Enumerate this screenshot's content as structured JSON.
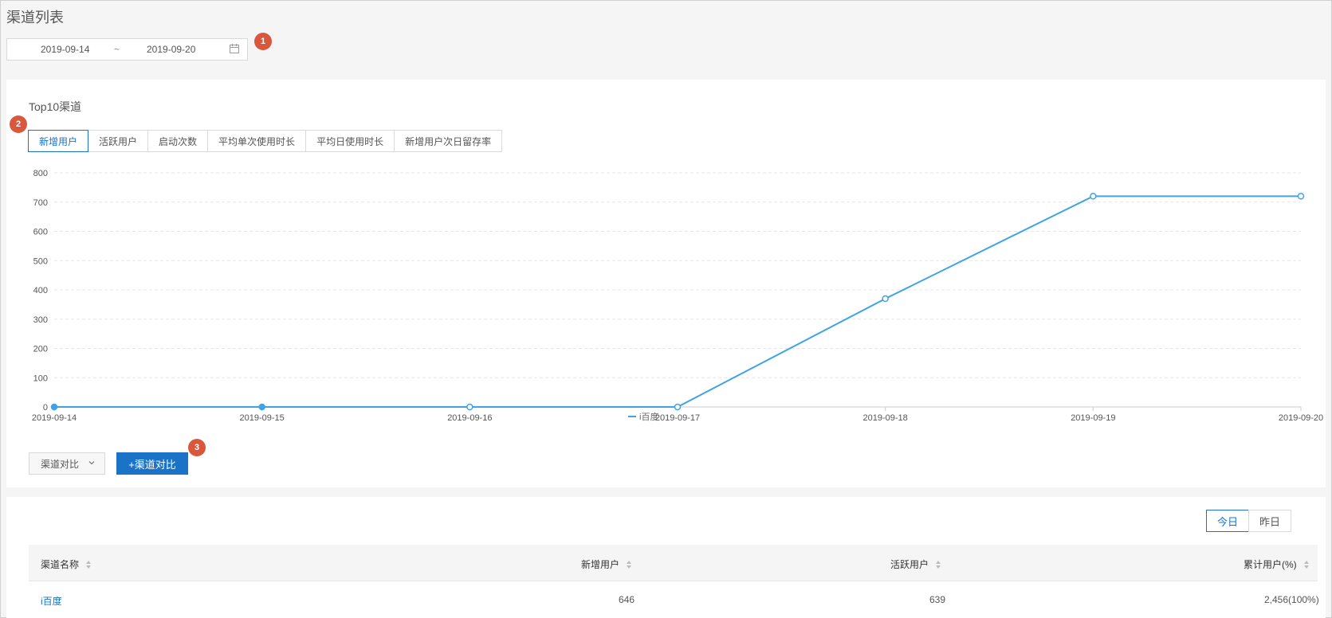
{
  "header": {
    "title": "渠道列表"
  },
  "date_range": {
    "start": "2019-09-14",
    "separator": "~",
    "end": "2019-09-20"
  },
  "badges": [
    "1",
    "2",
    "3"
  ],
  "top_section": {
    "label": "Top10渠道"
  },
  "metric_tabs": [
    {
      "label": "新增用户",
      "active": true
    },
    {
      "label": "活跃用户",
      "active": false
    },
    {
      "label": "启动次数",
      "active": false
    },
    {
      "label": "平均单次使用时长",
      "active": false
    },
    {
      "label": "平均日使用时长",
      "active": false
    },
    {
      "label": "新增用户次日留存率",
      "active": false
    }
  ],
  "chart_data": {
    "type": "line",
    "categories": [
      "2019-09-14",
      "2019-09-15",
      "2019-09-16",
      "2019-09-17",
      "2019-09-18",
      "2019-09-19",
      "2019-09-20"
    ],
    "series": [
      {
        "name": "i百度",
        "values": [
          0,
          0,
          0,
          0,
          370,
          720,
          720
        ],
        "color": "#3fa3e6"
      }
    ],
    "yticks": [
      0,
      100,
      200,
      300,
      400,
      500,
      600,
      700,
      800
    ],
    "ylim": [
      0,
      800
    ],
    "title": "",
    "xlabel": "",
    "ylabel": "",
    "grid": true,
    "legend": "bottom-center"
  },
  "controls": {
    "compare_select_label": "渠道对比",
    "add_compare_label": "+渠道对比"
  },
  "day_toggle": {
    "today": "今日",
    "yesterday": "昨日",
    "active": "today"
  },
  "table": {
    "headers": [
      "渠道名称",
      "新增用户",
      "活跃用户",
      "累计用户(%)"
    ],
    "rows": [
      {
        "name": "i百度",
        "new_users": "646",
        "active_users": "639",
        "total_users": "2,456(100%)"
      }
    ]
  },
  "colors": {
    "accent": "#1a73c7",
    "badge": "#d9573b",
    "line": "#3fa3e6"
  },
  "icons": {
    "calendar": "calendar-icon",
    "chevron": "chevron-down-icon",
    "sort": "sort-icon"
  }
}
